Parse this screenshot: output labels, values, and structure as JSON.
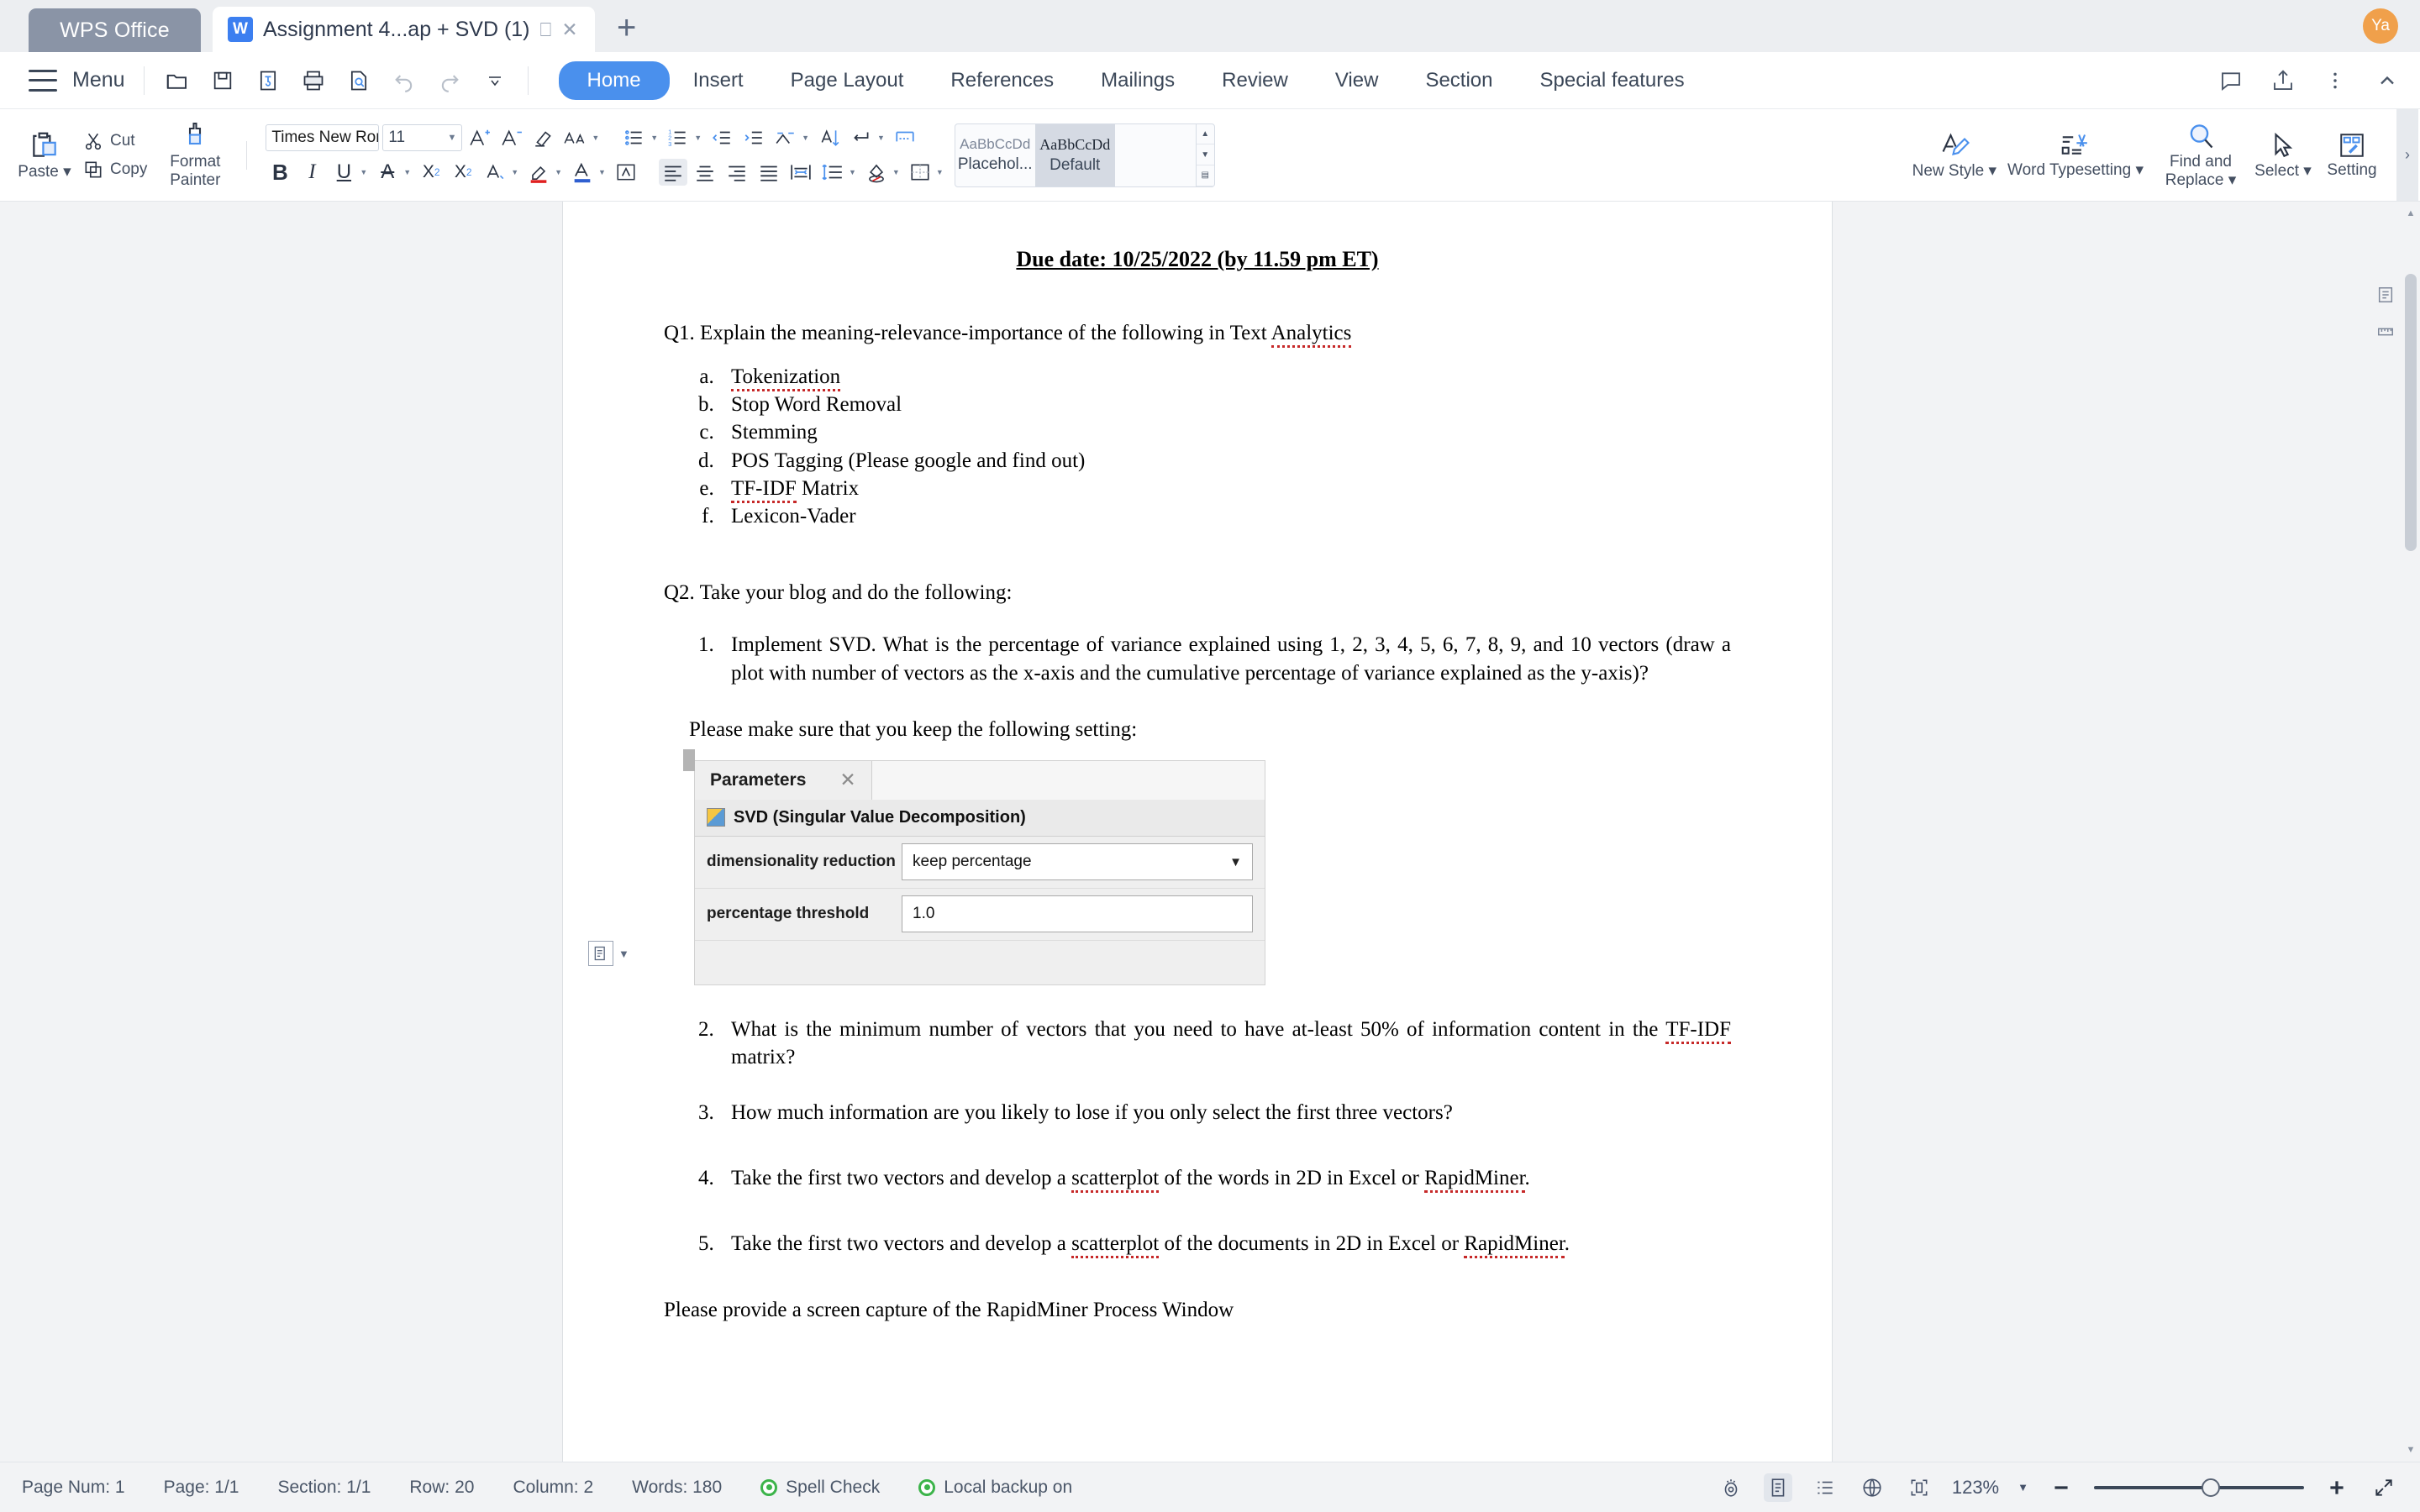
{
  "titlebar": {
    "app_badge": "WPS Office",
    "tab_title": "Assignment 4...ap + SVD (1)",
    "tab_logo": "w-logo",
    "present_icon": "presentation-icon",
    "close_icon": "close-icon",
    "new_tab_icon": "plus-icon",
    "avatar_initials": "Ya"
  },
  "menurow": {
    "menu_label": "Menu",
    "quick_access": [
      {
        "name": "open-file-icon"
      },
      {
        "name": "save-icon"
      },
      {
        "name": "save-as-icon"
      },
      {
        "name": "print-icon"
      },
      {
        "name": "print-preview-icon"
      },
      {
        "name": "undo-icon"
      },
      {
        "name": "redo-icon"
      },
      {
        "name": "customize-quick-access-icon"
      }
    ],
    "tabs": [
      {
        "label": "Home",
        "active": true
      },
      {
        "label": "Insert",
        "active": false
      },
      {
        "label": "Page Layout",
        "active": false
      },
      {
        "label": "References",
        "active": false
      },
      {
        "label": "Mailings",
        "active": false
      },
      {
        "label": "Review",
        "active": false
      },
      {
        "label": "View",
        "active": false
      },
      {
        "label": "Section",
        "active": false
      },
      {
        "label": "Special features",
        "active": false
      }
    ],
    "right_icons": [
      {
        "name": "comment-icon"
      },
      {
        "name": "share-icon"
      },
      {
        "name": "more-options-icon"
      },
      {
        "name": "collapse-ribbon-icon"
      }
    ]
  },
  "ribbon": {
    "paste_label": "Paste",
    "cut_label": "Cut",
    "copy_label": "Copy",
    "format_painter_label": "Format\nPainter",
    "format_painter_line1": "Format",
    "format_painter_line2": "Painter",
    "font_name": "Times New Roma",
    "font_size": "11",
    "grow_font_icon": "grow-font-icon",
    "shrink_font_icon": "shrink-font-icon",
    "clear_format_icon": "clear-formatting-icon",
    "change_case_icon": "change-case-icon",
    "bold_label": "B",
    "italic_label": "I",
    "underline_label": "U",
    "strikethrough_label": "A",
    "superscript_label": "X",
    "superscript_sup": "2",
    "subscript_label": "X",
    "subscript_sub": "2",
    "text_effects_label": "A",
    "highlight_label": "",
    "font_color_label": "A",
    "char_border_label": "A",
    "styles": [
      {
        "preview": "AaBbCcDd",
        "name": "Placehol...",
        "selected": false
      },
      {
        "preview": "AaBbCcDd",
        "name": "Default",
        "selected": true
      }
    ],
    "new_style_label": "New Style",
    "word_typesetting_label": "Word Typesetting",
    "find_replace_line1": "Find and",
    "find_replace_line2": "Replace",
    "select_label": "Select",
    "settings_label": "Setting"
  },
  "document": {
    "due_date": "Due date: 10/25/2022 (by 11.59 pm ET)",
    "q1_intro": "Q1. Explain the meaning-relevance-importance of the following in Text Analytics",
    "q1_items": [
      "Tokenization",
      "Stop Word Removal",
      "Stemming",
      "POS Tagging (Please google and find out)",
      "TF-IDF Matrix",
      "Lexicon-Vader"
    ],
    "q2_intro": "Q2. Take your blog and do the following:",
    "q2_item1": "Implement SVD. What is the percentage of variance explained using 1, 2, 3, 4, 5, 6, 7, 8, 9, and 10 vectors (draw a plot with number of vectors as the x-axis and the cumulative percentage of variance explained as the y-axis)?",
    "setting_note": "Please make sure that you keep the following setting:",
    "parameters_panel": {
      "title": "Parameters",
      "close_icon": "close-icon",
      "operator_name": "SVD (Singular Value Decomposition)",
      "rows": [
        {
          "label": "dimensionality reduction",
          "value": "keep percentage",
          "type": "dropdown"
        },
        {
          "label": "percentage threshold",
          "value": "1.0",
          "type": "text"
        }
      ]
    },
    "q2_item2": "What is the minimum number of vectors that you need to have at-least 50% of information content in the TF-IDF matrix?",
    "q2_item3": "How much information are you likely to lose if you only select the first three vectors?",
    "q2_item4": "Take the first two vectors and develop a scatterplot of the words in 2D in Excel or RapidMiner.",
    "q2_item5": "Take the first two vectors and develop a scatterplot of the documents in 2D in Excel or RapidMiner.",
    "closing_line": "Please provide a screen capture of the RapidMiner Process Window"
  },
  "statusbar": {
    "page_num": "Page Num: 1",
    "page": "Page: 1/1",
    "section": "Section: 1/1",
    "row": "Row: 20",
    "column": "Column: 2",
    "words": "Words: 180",
    "spell_check": "Spell Check",
    "local_backup": "Local backup on",
    "zoom_level": "123%",
    "view_icons": [
      {
        "name": "read-mode-icon"
      },
      {
        "name": "page-view-icon",
        "selected": true
      },
      {
        "name": "outline-view-icon",
        "selected": false
      },
      {
        "name": "web-view-icon",
        "selected": false
      },
      {
        "name": "fit-page-icon",
        "selected": false
      }
    ],
    "zoom_out_icon": "zoom-out-icon",
    "zoom_in_icon": "zoom-in-icon",
    "fullscreen_icon": "fullscreen-icon"
  },
  "colors": {
    "accent": "#4a90ed",
    "badge": "#8a94a6",
    "status_green": "#3cb44a",
    "avatar": "#f0a04b"
  }
}
